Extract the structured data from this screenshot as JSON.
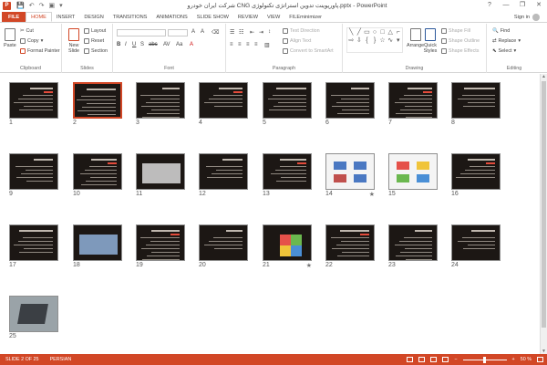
{
  "titlebar": {
    "app_letter": "P",
    "title": "شرکت ایران خودرو CNG پاورپوینت تدوین استراتژی تکنولوژی.pptx - PowerPoint",
    "help": "?",
    "minimize": "—",
    "restore": "❐",
    "close": "✕"
  },
  "qat": {
    "save": "💾",
    "undo": "↶",
    "redo": "↷",
    "start": "▣",
    "more": "▾"
  },
  "tabs": [
    "FILE",
    "HOME",
    "INSERT",
    "DESIGN",
    "TRANSITIONS",
    "ANIMATIONS",
    "SLIDE SHOW",
    "REVIEW",
    "VIEW",
    "FILEminimizer"
  ],
  "active_tab": "HOME",
  "signin": "Sign in",
  "ribbon": {
    "clipboard": {
      "label": "Clipboard",
      "paste": "Paste",
      "cut": "Cut",
      "copy": "Copy",
      "format_painter": "Format Painter"
    },
    "slides": {
      "label": "Slides",
      "new_slide": "New Slide",
      "layout": "Layout",
      "reset": "Reset",
      "section": "Section"
    },
    "font": {
      "label": "Font"
    },
    "paragraph": {
      "label": "Paragraph",
      "text_direction": "Text Direction",
      "align_text": "Align Text",
      "convert_smartart": "Convert to SmartArt"
    },
    "drawing": {
      "label": "Drawing",
      "arrange": "Arrange",
      "quick_styles": "Quick Styles",
      "shape_fill": "Shape Fill",
      "shape_outline": "Shape Outline",
      "shape_effects": "Shape Effects"
    },
    "editing": {
      "label": "Editing",
      "find": "Find",
      "replace": "Replace",
      "select": "Select"
    }
  },
  "slides": [
    {
      "num": "1",
      "selected": false,
      "star": ""
    },
    {
      "num": "2",
      "selected": true,
      "star": ""
    },
    {
      "num": "3",
      "selected": false,
      "star": ""
    },
    {
      "num": "4",
      "selected": false,
      "star": ""
    },
    {
      "num": "5",
      "selected": false,
      "star": ""
    },
    {
      "num": "6",
      "selected": false,
      "star": ""
    },
    {
      "num": "7",
      "selected": false,
      "star": ""
    },
    {
      "num": "8",
      "selected": false,
      "star": ""
    },
    {
      "num": "9",
      "selected": false,
      "star": ""
    },
    {
      "num": "10",
      "selected": false,
      "star": ""
    },
    {
      "num": "11",
      "selected": false,
      "star": ""
    },
    {
      "num": "12",
      "selected": false,
      "star": ""
    },
    {
      "num": "13",
      "selected": false,
      "star": ""
    },
    {
      "num": "14",
      "selected": false,
      "star": "★"
    },
    {
      "num": "15",
      "selected": false,
      "star": ""
    },
    {
      "num": "16",
      "selected": false,
      "star": ""
    },
    {
      "num": "17",
      "selected": false,
      "star": ""
    },
    {
      "num": "18",
      "selected": false,
      "star": ""
    },
    {
      "num": "19",
      "selected": false,
      "star": ""
    },
    {
      "num": "20",
      "selected": false,
      "star": ""
    },
    {
      "num": "21",
      "selected": false,
      "star": "★"
    },
    {
      "num": "22",
      "selected": false,
      "star": ""
    },
    {
      "num": "23",
      "selected": false,
      "star": ""
    },
    {
      "num": "24",
      "selected": false,
      "star": ""
    },
    {
      "num": "25",
      "selected": false,
      "star": ""
    }
  ],
  "status": {
    "slide_info": "SLIDE 2 OF 25",
    "language": "PERSIAN",
    "zoom": "50 %"
  },
  "colors": {
    "accent": "#d24726",
    "thumb_bg": "#1c1714"
  }
}
